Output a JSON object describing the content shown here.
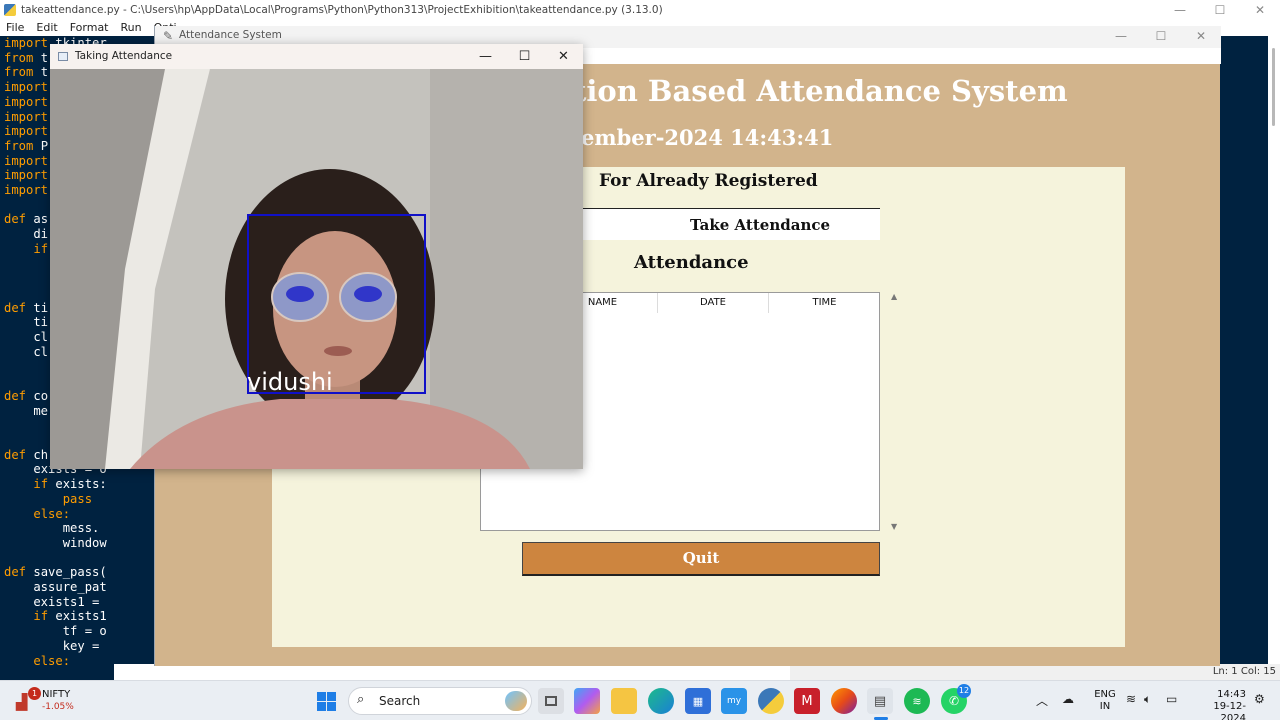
{
  "idle": {
    "title": "takeattendance.py - C:\\Users\\hp\\AppData\\Local\\Programs\\Python\\Python313\\ProjectExhibition\\takeattendance.py (3.13.0)",
    "menu": [
      "File",
      "Edit",
      "Format",
      "Run",
      "Opti"
    ],
    "code_lines": [
      "import tkinter",
      "from t",
      "from t",
      "import",
      "import",
      "import",
      "import",
      "from P",
      "import",
      "import",
      "import",
      "",
      "def as",
      "    di",
      "    if",
      "",
      "",
      "",
      "def ti",
      "    ti",
      "    cl",
      "    cl",
      "",
      "",
      "def co",
      "    me",
      "",
      "",
      "def ch",
      "    exists = o",
      "    if exists:",
      "        pass",
      "    else:",
      "        mess.",
      "        window",
      "",
      "def save_pass(",
      "    assure_pat",
      "    exists1 =",
      "    if exists1",
      "        tf = o",
      "        key =",
      "    else:"
    ],
    "status": "Ln: 1   Col: 15"
  },
  "attendance_window": {
    "title": "Attendance System",
    "heading": "tion Based Attendance System",
    "datetime": "ember-2024 14:43:41",
    "panel_heading": "For Already Registered",
    "take_attendance_button": "Take Attendance",
    "attendance_label": "Attendance",
    "table_columns": [
      "",
      "NAME",
      "DATE",
      "TIME"
    ],
    "table_rows": [],
    "quit_button": "Quit"
  },
  "camera_window": {
    "title": "Taking Attendance",
    "detected_name": "vidushi",
    "box_color": "#1010c8"
  },
  "taskbar": {
    "widget_label": "NIFTY",
    "widget_change": "-1.05%",
    "widget_badge": "1",
    "search_placeholder": "Search",
    "whatsapp_badge": "12",
    "lang_line1": "ENG",
    "lang_line2": "IN",
    "time": "14:43",
    "date": "19-12-2024",
    "accent": "#1f7ee6"
  },
  "window_controls": {
    "minimize": "—",
    "maximize": "☐",
    "close": "✕"
  }
}
